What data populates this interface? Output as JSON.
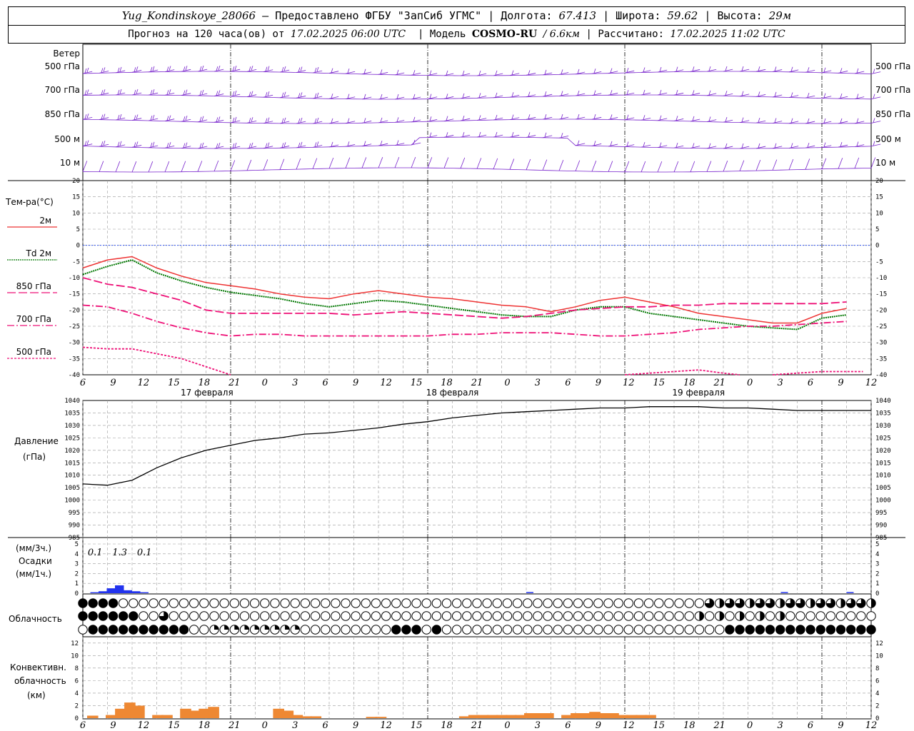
{
  "header": {
    "station": "Yug_Kondinskoye_28066",
    "provided": "Предоставлено ФГБУ \"ЗапСиб УГМС\"",
    "lon_label": "Долгота:",
    "lon": "67.413",
    "lat_label": "Широта:",
    "lat": "59.62",
    "alt_label": "Высота:",
    "alt": "29м",
    "forecast": "Прогноз на 120 часа(ов) от",
    "start": "17.02.2025 06:00 UTC",
    "model_label": "Модель",
    "model": "COSMO-RU",
    "res": "/ 6.6км",
    "calc_label": "Рассчитано:",
    "calc": "17.02.2025 11:02 UTC"
  },
  "panels": {
    "wind": {
      "title": "Ветер",
      "levels": [
        "500 гПа",
        "700 гПа",
        "850 гПа",
        "500 м",
        "10 м"
      ]
    },
    "temp": {
      "title": "Тем-ра(°C)",
      "legend": [
        "2м",
        "Td 2м",
        "850 гПа",
        "700 гПа",
        "500 гПа"
      ],
      "ticks": [
        "20",
        "15",
        "10",
        "5",
        "0",
        "-5",
        "-10",
        "-15",
        "-20",
        "-25",
        "-30",
        "-35",
        "-40"
      ]
    },
    "pressure": {
      "title1": "Давление",
      "title2": "(гПа)",
      "ticks": [
        "1040",
        "1035",
        "1030",
        "1025",
        "1020",
        "1015",
        "1010",
        "1005",
        "1000",
        "995",
        "990",
        "985"
      ]
    },
    "precip": {
      "unit1": "(мм/3ч.)",
      "title": "Осадки",
      "unit2": "(мм/1ч.)",
      "ticks": [
        "5",
        "4",
        "3",
        "2",
        "1",
        "0"
      ],
      "totals": [
        "0.1",
        "1.3",
        "0.1"
      ]
    },
    "cloud": {
      "title": "Облачность"
    },
    "conv": {
      "title1": "Конвективн.",
      "title2": "облачность",
      "title3": "(км)",
      "ticks": [
        "12",
        "10",
        "8",
        "6",
        "4",
        "2",
        "0"
      ]
    }
  },
  "axis": {
    "hours": [
      "6",
      "9",
      "12",
      "15",
      "18",
      "21",
      "0",
      "3",
      "6",
      "9",
      "12",
      "15",
      "18",
      "21",
      "0",
      "3",
      "6",
      "9",
      "12",
      "15",
      "18",
      "21",
      "0",
      "3",
      "6",
      "9",
      "12"
    ],
    "dates": [
      "17 февраля",
      "18 февраля",
      "19 февраля"
    ]
  },
  "colors": {
    "t2m": "#ee3333",
    "td2m": "#007700",
    "t850": "#ee1177",
    "t700": "#ee1177",
    "t500": "#ee1177",
    "wind": "#7722cc",
    "precip": "#2233ee",
    "conv": "#ee8833",
    "pressure": "#000000"
  },
  "chart_data": [
    {
      "type": "line",
      "x_hours": [
        0,
        3,
        6,
        9,
        12,
        15,
        18,
        21,
        24,
        27,
        30,
        33,
        36,
        39,
        42,
        45,
        48,
        51,
        54,
        57,
        60,
        63,
        66,
        69,
        72,
        75,
        78
      ],
      "ylim": [
        -40,
        20
      ],
      "series": [
        {
          "name": "2м",
          "values": [
            -7,
            -4.5,
            -3.5,
            -7,
            -9.5,
            -11.5,
            -12.5,
            -13.5,
            -15,
            -16,
            -16.5,
            -15,
            -14,
            -15,
            -16,
            -16.5,
            -17.5,
            -18.5,
            -19,
            -20.5,
            -19,
            -17,
            -16,
            -17.5,
            -19,
            -21,
            -22,
            -23,
            -24,
            -24,
            -21,
            -19.5
          ],
          "x": [
            0,
            3,
            6,
            9,
            12,
            15,
            18,
            21,
            24,
            27,
            30,
            33,
            36,
            39,
            42,
            45,
            48,
            51,
            54,
            57,
            60,
            63,
            66,
            69,
            72,
            75,
            78,
            81,
            84,
            87,
            90,
            93
          ]
        },
        {
          "name": "Td 2м",
          "values": [
            -9,
            -6.5,
            -4.5,
            -8.5,
            -11,
            -13,
            -14.5,
            -15.5,
            -16.5,
            -18,
            -19,
            -18,
            -17,
            -17.5,
            -18.5,
            -19.5,
            -20.5,
            -21.5,
            -22,
            -22,
            -20,
            -19,
            -19,
            -21,
            -22,
            -23,
            -24,
            -25,
            -25.5,
            -26,
            -22.5,
            -21.5
          ],
          "x": [
            0,
            3,
            6,
            9,
            12,
            15,
            18,
            21,
            24,
            27,
            30,
            33,
            36,
            39,
            42,
            45,
            48,
            51,
            54,
            57,
            60,
            63,
            66,
            69,
            72,
            75,
            78,
            81,
            84,
            87,
            90,
            93
          ]
        },
        {
          "name": "850 гПа",
          "values": [
            -10,
            -12,
            -13,
            -15,
            -17,
            -20,
            -21,
            -21,
            -21,
            -21,
            -21,
            -21.5,
            -21,
            -20.5,
            -21,
            -21.5,
            -22,
            -22.5,
            -22,
            -21,
            -20,
            -19.5,
            -19,
            -19,
            -18.5,
            -18.5,
            -18,
            -18,
            -18,
            -18,
            -18,
            -17.5
          ],
          "x": [
            0,
            3,
            6,
            9,
            12,
            15,
            18,
            21,
            24,
            27,
            30,
            33,
            36,
            39,
            42,
            45,
            48,
            51,
            54,
            57,
            60,
            63,
            66,
            69,
            72,
            75,
            78,
            81,
            84,
            87,
            90,
            93
          ]
        },
        {
          "name": "700 гПа",
          "values": [
            -18.5,
            -19,
            -21,
            -23.5,
            -25.5,
            -27,
            -28,
            -27.5,
            -27.5,
            -28,
            -28,
            -28,
            -28,
            -28,
            -28,
            -27.5,
            -27.5,
            -27,
            -27,
            -27,
            -27.5,
            -28,
            -28,
            -27.5,
            -27,
            -26,
            -25.5,
            -25,
            -25,
            -24.5,
            -24,
            -23.5
          ],
          "x": [
            0,
            3,
            6,
            9,
            12,
            15,
            18,
            21,
            24,
            27,
            30,
            33,
            36,
            39,
            42,
            45,
            48,
            51,
            54,
            57,
            60,
            63,
            66,
            69,
            72,
            75,
            78,
            81,
            84,
            87,
            90,
            93
          ]
        },
        {
          "name": "500 гПа",
          "values": [
            -31.5,
            -32,
            -32,
            -33.5,
            -35,
            -37.5,
            -40
          ],
          "x": [
            0,
            3,
            6,
            9,
            12,
            15,
            18
          ]
        },
        {
          "name": "500 гПа",
          "values": [
            -40,
            -39.5,
            -39,
            -38.5,
            -39.5,
            -40
          ],
          "x": [
            66,
            69,
            72,
            75,
            78,
            80
          ]
        },
        {
          "name": "500 гПа",
          "values": [
            -40,
            -39.5,
            -39,
            -39,
            -39
          ],
          "x": [
            84,
            87,
            90,
            93,
            95
          ]
        }
      ]
    },
    {
      "type": "line",
      "ylim": [
        985,
        1040
      ],
      "x": [
        0,
        3,
        6,
        9,
        12,
        15,
        18,
        21,
        24,
        27,
        30,
        33,
        36,
        39,
        42,
        45,
        48,
        51,
        54,
        57,
        60,
        63,
        66,
        69,
        72,
        75,
        78,
        81,
        84,
        87,
        90,
        93,
        96
      ],
      "series": [
        {
          "name": "Давление",
          "values": [
            1006.5,
            1006,
            1008,
            1013,
            1017,
            1020,
            1022,
            1024,
            1025,
            1026.5,
            1027,
            1028,
            1029,
            1030.5,
            1031.5,
            1033,
            1034,
            1035,
            1035.5,
            1036,
            1036.5,
            1037,
            1037,
            1037.5,
            1037.5,
            1037.5,
            1037,
            1037,
            1036.5,
            1036,
            1036,
            1036,
            1036
          ]
        }
      ]
    },
    {
      "type": "bar",
      "ylim": [
        0,
        5
      ],
      "x": [
        1,
        2,
        3,
        4,
        5,
        6,
        7
      ],
      "series": [
        {
          "name": "Осадки",
          "values": [
            0.1,
            0.2,
            0.5,
            0.8,
            0.3,
            0.2,
            0.1
          ]
        }
      ],
      "totals_3h": [
        "0.1",
        "1.3",
        "0.1"
      ]
    },
    {
      "type": "bar",
      "ylim": [
        0,
        13
      ],
      "series": [
        {
          "name": "Конвективн. облачность",
          "x": [
            0,
            2,
            3,
            4,
            5,
            6,
            7,
            8,
            10,
            11,
            12,
            13,
            20,
            21,
            22,
            23,
            24,
            30,
            31,
            40,
            41,
            42,
            43,
            44,
            45,
            46,
            47,
            48,
            49,
            50,
            51,
            52,
            53,
            54,
            55,
            56,
            57,
            58,
            59,
            60
          ],
          "values": [
            0.4,
            0.5,
            1.5,
            2.5,
            2,
            0,
            0.5,
            0.5,
            1.5,
            1.2,
            1.5,
            1.8,
            1.5,
            1.2,
            0.5,
            0.3,
            0.3,
            0.2,
            0.2,
            0.3,
            0.5,
            0.5,
            0.5,
            0.5,
            0.5,
            0.5,
            0.8,
            0.8,
            0.8,
            0,
            0.5,
            0.8,
            0.8,
            1,
            0.8,
            0.8,
            0.5,
            0.5,
            0.5,
            0.5
          ]
        }
      ]
    }
  ]
}
